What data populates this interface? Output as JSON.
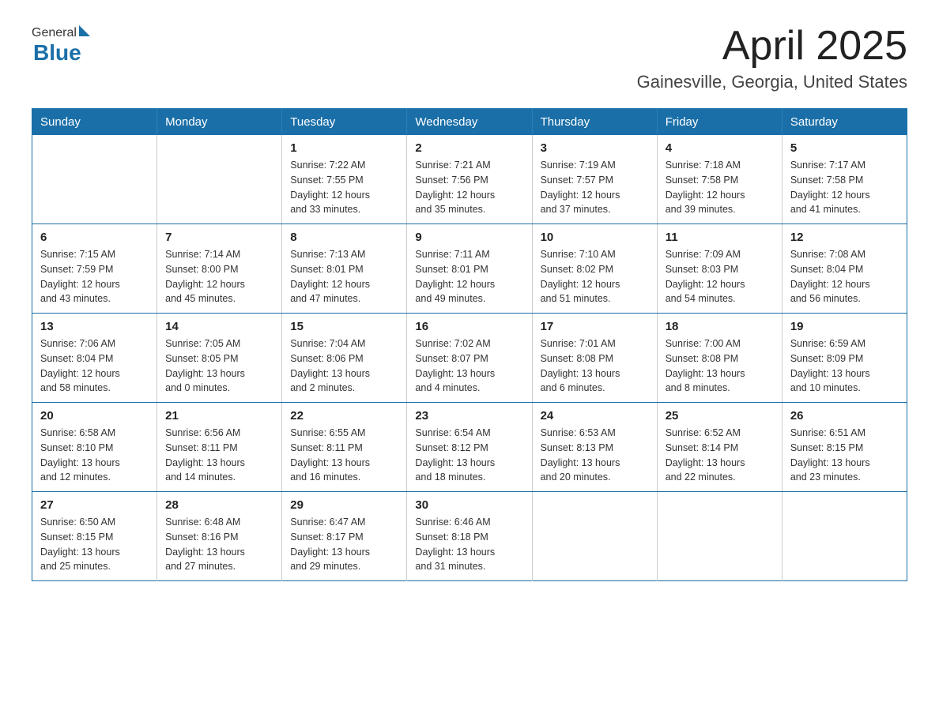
{
  "header": {
    "title": "April 2025",
    "subtitle": "Gainesville, Georgia, United States",
    "logo_general": "General",
    "logo_blue": "Blue"
  },
  "weekdays": [
    "Sunday",
    "Monday",
    "Tuesday",
    "Wednesday",
    "Thursday",
    "Friday",
    "Saturday"
  ],
  "weeks": [
    [
      {
        "day": "",
        "info": ""
      },
      {
        "day": "",
        "info": ""
      },
      {
        "day": "1",
        "info": "Sunrise: 7:22 AM\nSunset: 7:55 PM\nDaylight: 12 hours\nand 33 minutes."
      },
      {
        "day": "2",
        "info": "Sunrise: 7:21 AM\nSunset: 7:56 PM\nDaylight: 12 hours\nand 35 minutes."
      },
      {
        "day": "3",
        "info": "Sunrise: 7:19 AM\nSunset: 7:57 PM\nDaylight: 12 hours\nand 37 minutes."
      },
      {
        "day": "4",
        "info": "Sunrise: 7:18 AM\nSunset: 7:58 PM\nDaylight: 12 hours\nand 39 minutes."
      },
      {
        "day": "5",
        "info": "Sunrise: 7:17 AM\nSunset: 7:58 PM\nDaylight: 12 hours\nand 41 minutes."
      }
    ],
    [
      {
        "day": "6",
        "info": "Sunrise: 7:15 AM\nSunset: 7:59 PM\nDaylight: 12 hours\nand 43 minutes."
      },
      {
        "day": "7",
        "info": "Sunrise: 7:14 AM\nSunset: 8:00 PM\nDaylight: 12 hours\nand 45 minutes."
      },
      {
        "day": "8",
        "info": "Sunrise: 7:13 AM\nSunset: 8:01 PM\nDaylight: 12 hours\nand 47 minutes."
      },
      {
        "day": "9",
        "info": "Sunrise: 7:11 AM\nSunset: 8:01 PM\nDaylight: 12 hours\nand 49 minutes."
      },
      {
        "day": "10",
        "info": "Sunrise: 7:10 AM\nSunset: 8:02 PM\nDaylight: 12 hours\nand 51 minutes."
      },
      {
        "day": "11",
        "info": "Sunrise: 7:09 AM\nSunset: 8:03 PM\nDaylight: 12 hours\nand 54 minutes."
      },
      {
        "day": "12",
        "info": "Sunrise: 7:08 AM\nSunset: 8:04 PM\nDaylight: 12 hours\nand 56 minutes."
      }
    ],
    [
      {
        "day": "13",
        "info": "Sunrise: 7:06 AM\nSunset: 8:04 PM\nDaylight: 12 hours\nand 58 minutes."
      },
      {
        "day": "14",
        "info": "Sunrise: 7:05 AM\nSunset: 8:05 PM\nDaylight: 13 hours\nand 0 minutes."
      },
      {
        "day": "15",
        "info": "Sunrise: 7:04 AM\nSunset: 8:06 PM\nDaylight: 13 hours\nand 2 minutes."
      },
      {
        "day": "16",
        "info": "Sunrise: 7:02 AM\nSunset: 8:07 PM\nDaylight: 13 hours\nand 4 minutes."
      },
      {
        "day": "17",
        "info": "Sunrise: 7:01 AM\nSunset: 8:08 PM\nDaylight: 13 hours\nand 6 minutes."
      },
      {
        "day": "18",
        "info": "Sunrise: 7:00 AM\nSunset: 8:08 PM\nDaylight: 13 hours\nand 8 minutes."
      },
      {
        "day": "19",
        "info": "Sunrise: 6:59 AM\nSunset: 8:09 PM\nDaylight: 13 hours\nand 10 minutes."
      }
    ],
    [
      {
        "day": "20",
        "info": "Sunrise: 6:58 AM\nSunset: 8:10 PM\nDaylight: 13 hours\nand 12 minutes."
      },
      {
        "day": "21",
        "info": "Sunrise: 6:56 AM\nSunset: 8:11 PM\nDaylight: 13 hours\nand 14 minutes."
      },
      {
        "day": "22",
        "info": "Sunrise: 6:55 AM\nSunset: 8:11 PM\nDaylight: 13 hours\nand 16 minutes."
      },
      {
        "day": "23",
        "info": "Sunrise: 6:54 AM\nSunset: 8:12 PM\nDaylight: 13 hours\nand 18 minutes."
      },
      {
        "day": "24",
        "info": "Sunrise: 6:53 AM\nSunset: 8:13 PM\nDaylight: 13 hours\nand 20 minutes."
      },
      {
        "day": "25",
        "info": "Sunrise: 6:52 AM\nSunset: 8:14 PM\nDaylight: 13 hours\nand 22 minutes."
      },
      {
        "day": "26",
        "info": "Sunrise: 6:51 AM\nSunset: 8:15 PM\nDaylight: 13 hours\nand 23 minutes."
      }
    ],
    [
      {
        "day": "27",
        "info": "Sunrise: 6:50 AM\nSunset: 8:15 PM\nDaylight: 13 hours\nand 25 minutes."
      },
      {
        "day": "28",
        "info": "Sunrise: 6:48 AM\nSunset: 8:16 PM\nDaylight: 13 hours\nand 27 minutes."
      },
      {
        "day": "29",
        "info": "Sunrise: 6:47 AM\nSunset: 8:17 PM\nDaylight: 13 hours\nand 29 minutes."
      },
      {
        "day": "30",
        "info": "Sunrise: 6:46 AM\nSunset: 8:18 PM\nDaylight: 13 hours\nand 31 minutes."
      },
      {
        "day": "",
        "info": ""
      },
      {
        "day": "",
        "info": ""
      },
      {
        "day": "",
        "info": ""
      }
    ]
  ]
}
